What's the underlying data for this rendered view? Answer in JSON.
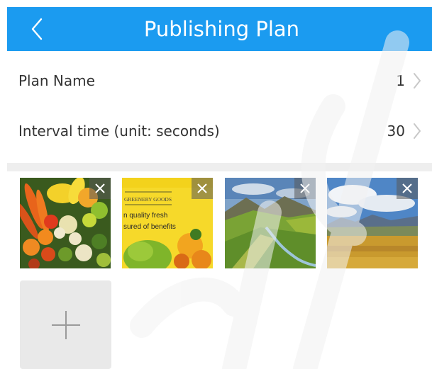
{
  "header": {
    "title": "Publishing Plan",
    "back_icon": "chevron-left-icon",
    "color": "#1b9bf0"
  },
  "settings": [
    {
      "label": "Plan Name",
      "value": "1"
    },
    {
      "label": "Interval time (unit: seconds)",
      "value": "30"
    }
  ],
  "media": {
    "images": [
      {
        "name": "vegetables-image"
      },
      {
        "name": "grocery-ad-image",
        "lines": [
          "GREENERY GOODS",
          "n quality fresh",
          "sured of benefits"
        ]
      },
      {
        "name": "green-valley-image"
      },
      {
        "name": "plateau-field-image"
      }
    ],
    "remove_icon": "close-icon",
    "add_icon": "plus-icon"
  }
}
